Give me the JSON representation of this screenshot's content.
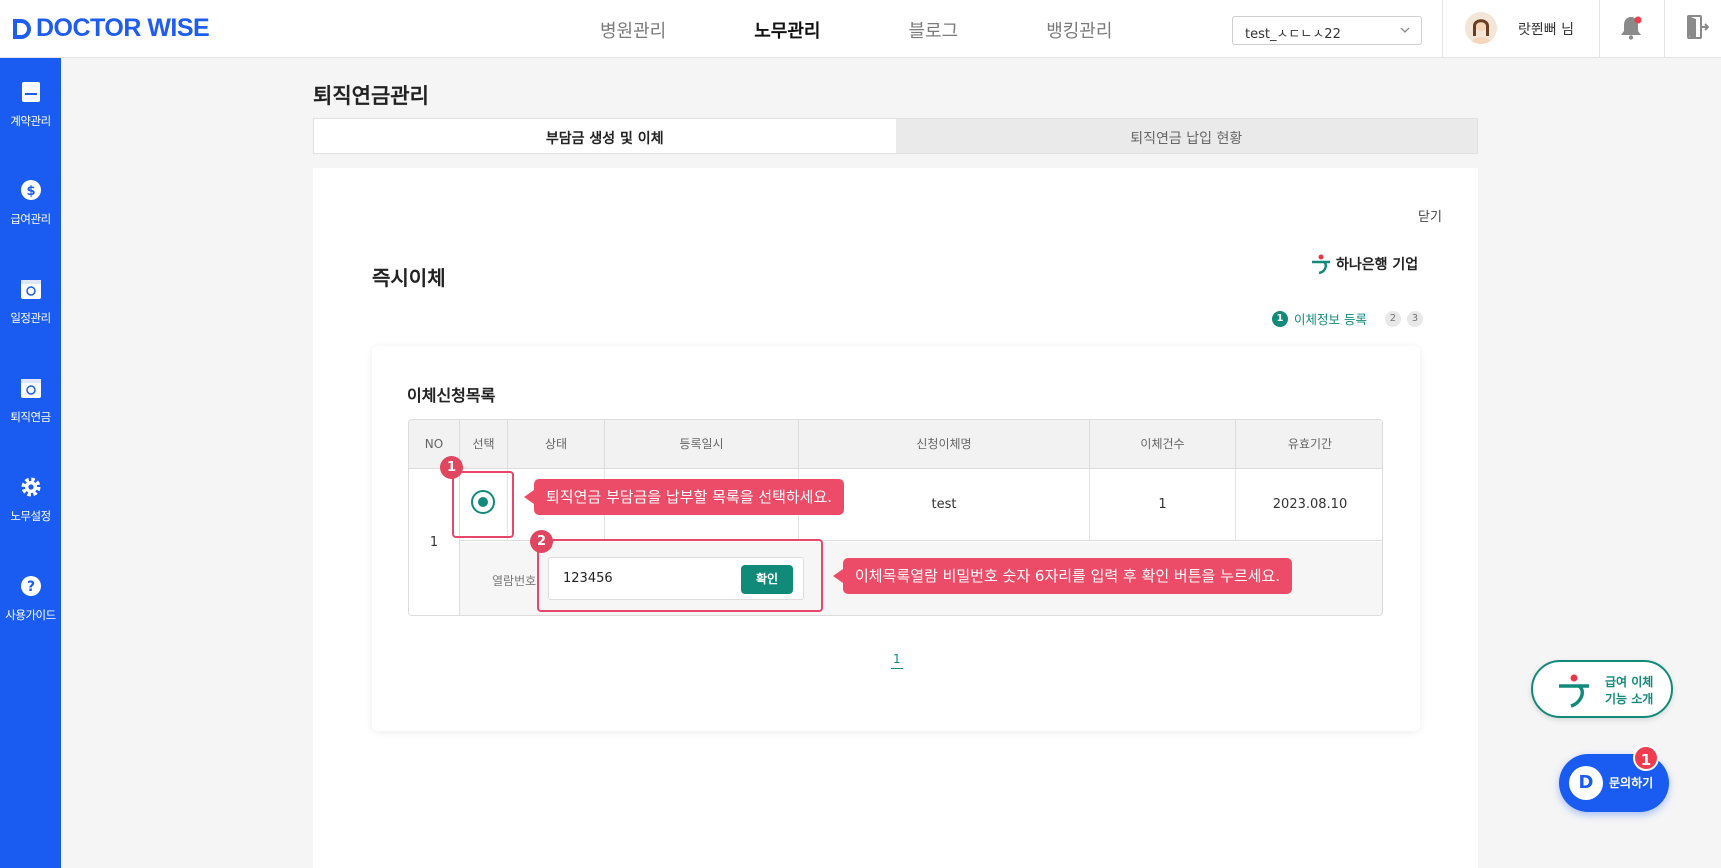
{
  "brand": {
    "name": "DOCTOR WISE",
    "color": "#1f5cf0"
  },
  "topnav": [
    {
      "label": "병원관리",
      "active": false
    },
    {
      "label": "노무관리",
      "active": true
    },
    {
      "label": "블로그",
      "active": false
    },
    {
      "label": "뱅킹관리",
      "active": false
    }
  ],
  "account": {
    "selected": "test_ㅅㄷㄴㅅ22"
  },
  "user": {
    "name": "랏쮠뻐 님"
  },
  "sidebar": {
    "items": [
      {
        "label": "계약관리",
        "icon": "document-icon"
      },
      {
        "label": "급여관리",
        "icon": "dollar-icon"
      },
      {
        "label": "일정관리",
        "icon": "calendar-icon"
      },
      {
        "label": "퇴직연금",
        "icon": "pension-icon"
      },
      {
        "label": "노무설정",
        "icon": "gear-icon"
      },
      {
        "label": "사용가이드",
        "icon": "help-icon"
      }
    ]
  },
  "page": {
    "title": "퇴직연금관리",
    "tabs": [
      {
        "label": "부담금 생성 및 이체",
        "active": true
      },
      {
        "label": "퇴직연금 납입 현황",
        "active": false
      }
    ],
    "close_label": "닫기",
    "section_title": "즉시이체",
    "bank_name": "하나은행 기업",
    "steps": [
      {
        "num": "1",
        "label": "이체정보 등록",
        "active": true
      },
      {
        "num": "2",
        "active": false
      },
      {
        "num": "3",
        "active": false
      }
    ]
  },
  "transfer_list": {
    "title": "이체신청목록",
    "columns": [
      "NO",
      "선택",
      "상태",
      "등록일시",
      "신청이체명",
      "이체건수",
      "유효기간"
    ],
    "rows": [
      {
        "no": "1",
        "status": "",
        "registered": "",
        "name": "test",
        "count": "1",
        "valid_until": "2023.08.10"
      }
    ],
    "password_label": "열람번호",
    "password_value": "123456",
    "confirm_label": "확인",
    "page": "1"
  },
  "guide": {
    "step1_badge": "1",
    "step1_text": "퇴직연금 부담금을 납부할 목록을 선택하세요.",
    "step2_badge": "2",
    "step2_text": "이체목록열람 비밀번호 숫자 6자리를 입력 후 확인 버튼을 누르세요."
  },
  "floating": {
    "intro_line1": "급여 이체",
    "intro_line2": "기능 소개",
    "chat_label": "문의하기",
    "chat_badge": "1"
  },
  "colors": {
    "accent": "#128a7a",
    "sidebar": "#1a5cf2",
    "highlight": "#e8476b"
  }
}
